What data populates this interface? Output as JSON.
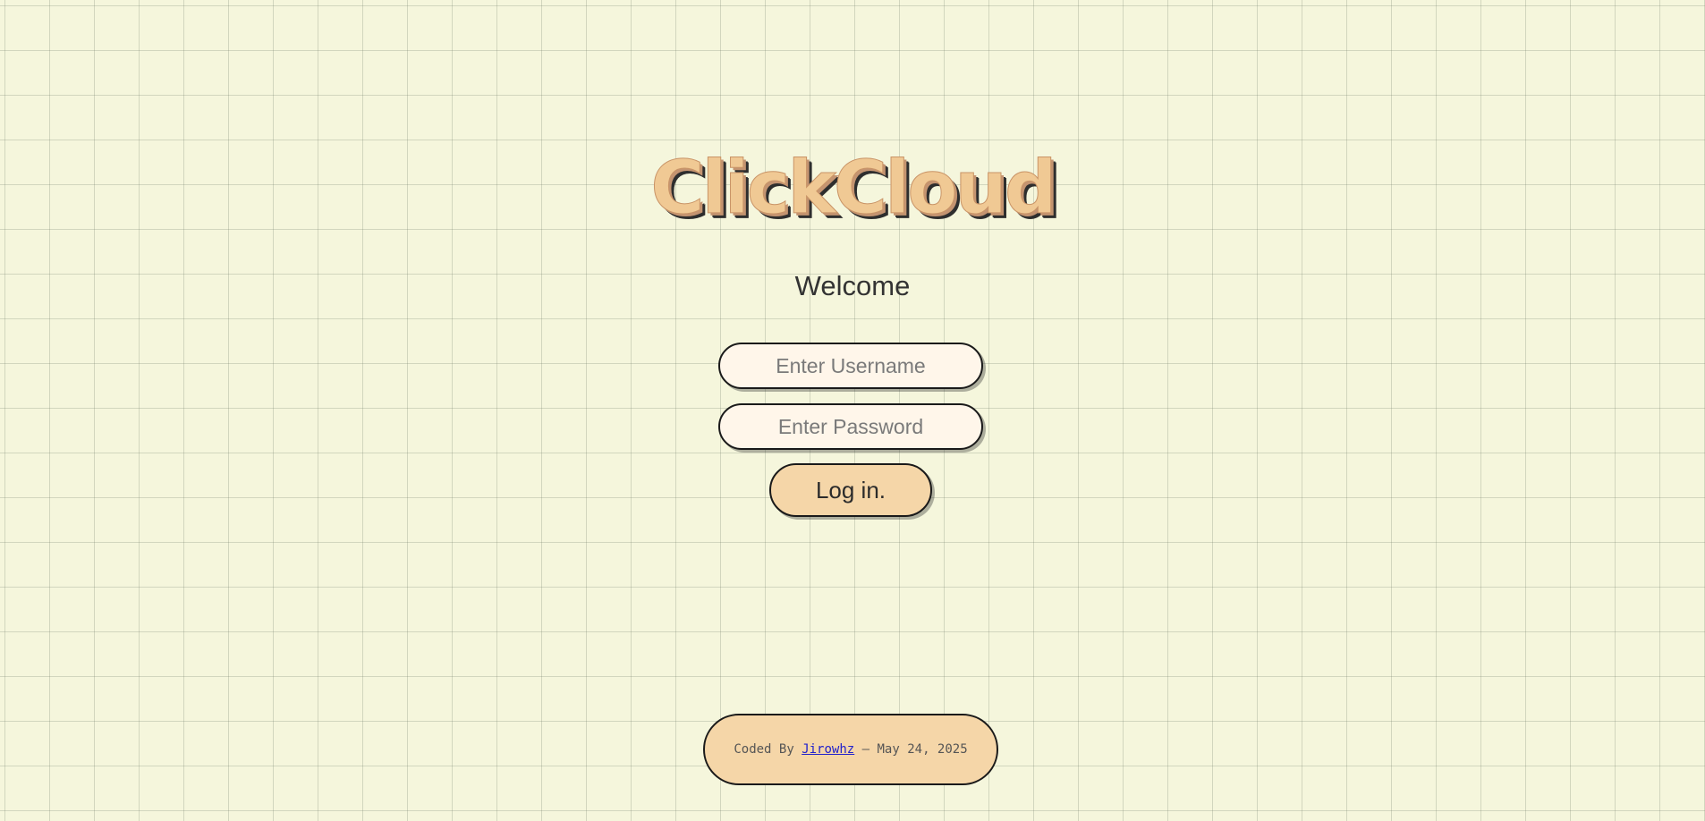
{
  "brand": {
    "logo_text": "ClickCloud"
  },
  "welcome": {
    "title": "Welcome"
  },
  "form": {
    "username_placeholder": "Enter Username",
    "password_placeholder": "Enter Password",
    "username_value": "",
    "password_value": "",
    "login_label": "Log in."
  },
  "footer": {
    "prefix": "Coded By ",
    "author": "Jirowhz",
    "suffix": " — May 24, 2025"
  },
  "colors": {
    "background": "#f5f6dc",
    "accent": "#f5d6a8",
    "input_bg": "#fff6ea",
    "link": "#2222cc"
  }
}
